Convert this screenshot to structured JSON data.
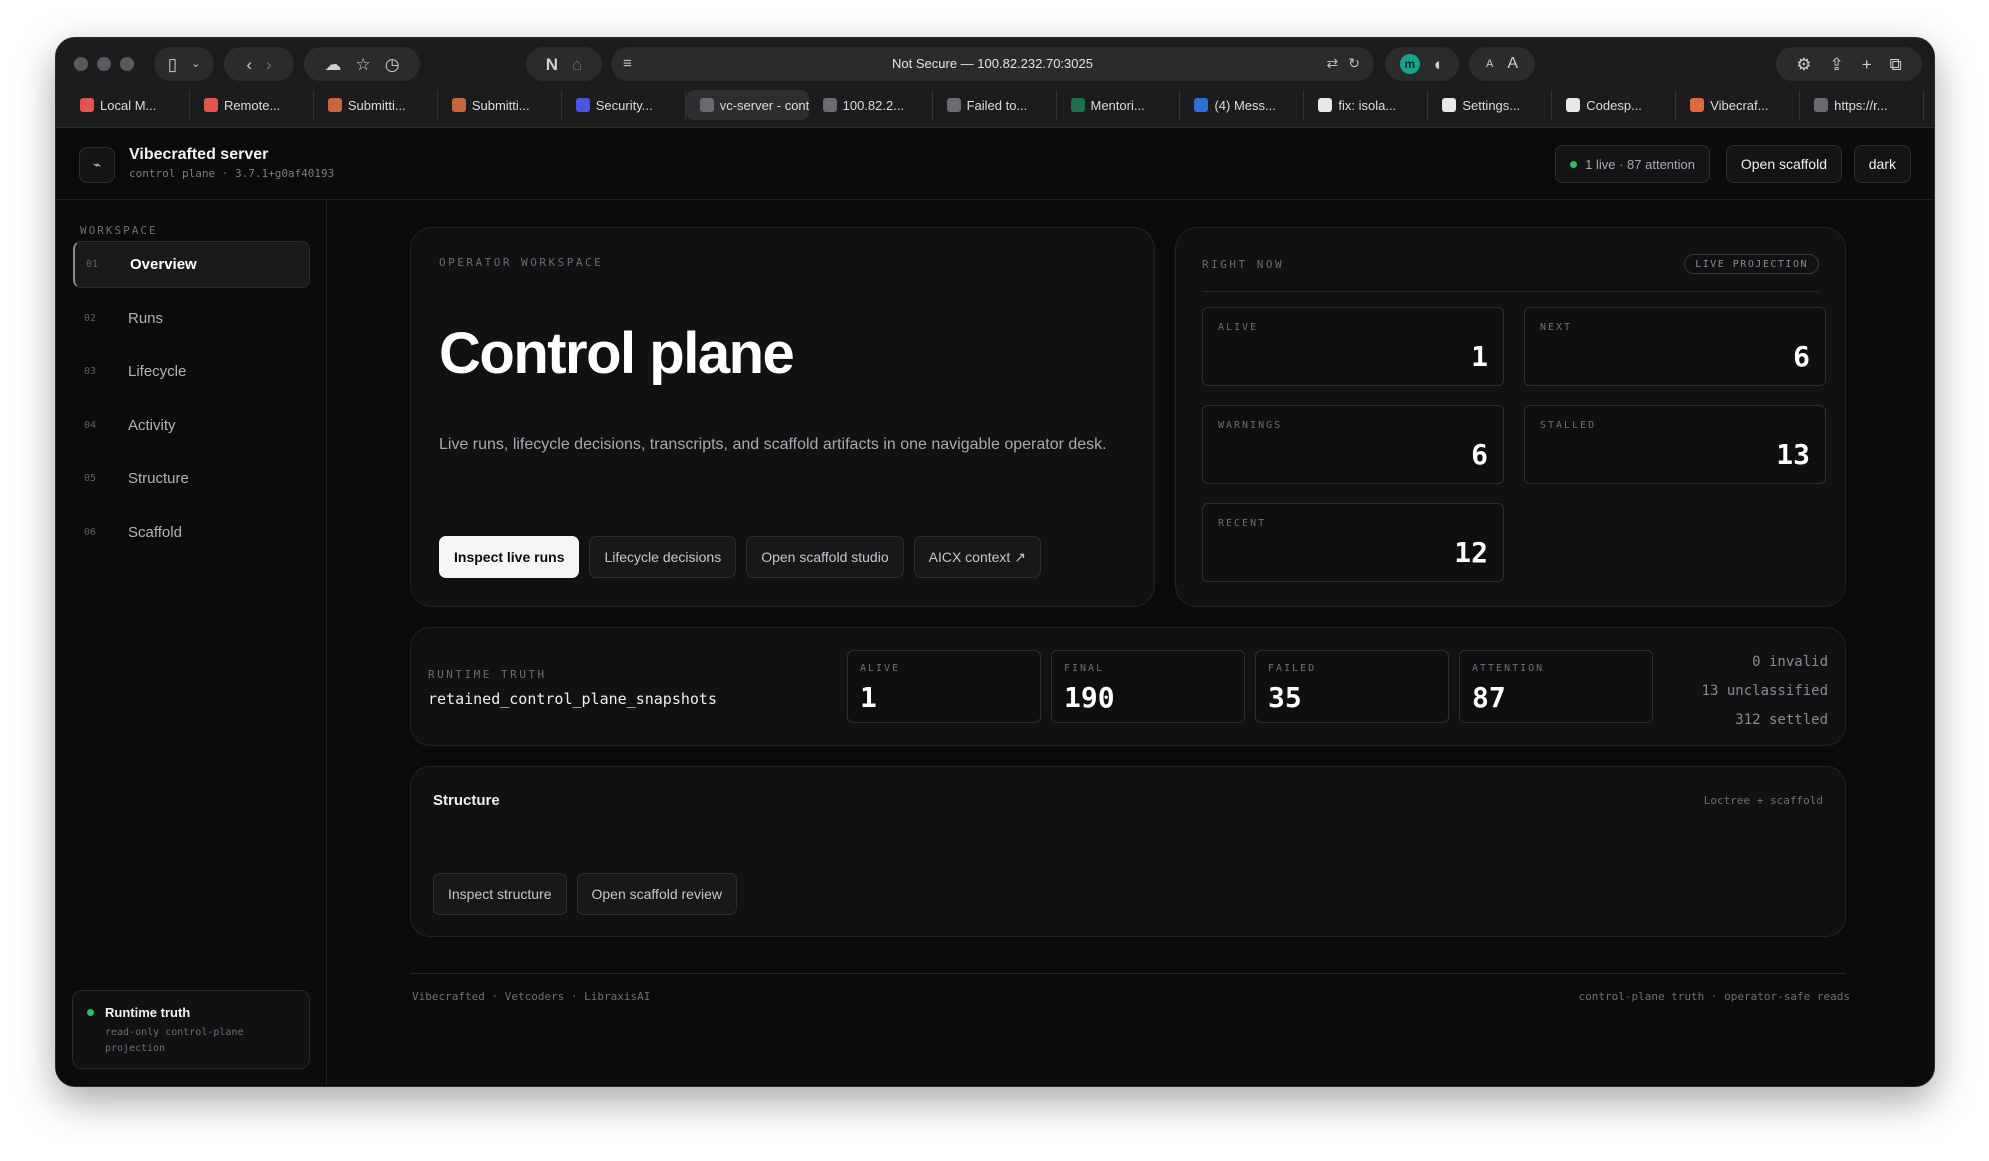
{
  "browser": {
    "url": "Not Secure — 100.82.232.70:3025",
    "ext_initial": "m",
    "text_size_small": "A",
    "text_size_large": "A",
    "tabs": [
      {
        "label": "Local M...",
        "color": "#e0564a"
      },
      {
        "label": "Remote...",
        "color": "#e0564a"
      },
      {
        "label": "Submitti...",
        "color": "#c9653b"
      },
      {
        "label": "Submitti...",
        "color": "#c9653b"
      },
      {
        "label": "Security...",
        "color": "#4a55e0"
      },
      {
        "label": "vc-server - control pl...",
        "color": "#6a6a70"
      },
      {
        "label": "100.82.2...",
        "color": "#6a6a70"
      },
      {
        "label": "Failed to...",
        "color": "#6a6a70"
      },
      {
        "label": "Mentori...",
        "color": "#1f6f4a"
      },
      {
        "label": "(4) Mess...",
        "color": "#2f6fd1"
      },
      {
        "label": "fix: isola...",
        "color": "#e8e8ea"
      },
      {
        "label": "Settings...",
        "color": "#e8e8ea"
      },
      {
        "label": "Codesp...",
        "color": "#e8e8ea"
      },
      {
        "label": "Vibecraf...",
        "color": "#e06a3a"
      },
      {
        "label": "https://r...",
        "color": "#6a6a70"
      }
    ],
    "active_tab_index": 5
  },
  "header": {
    "logo_glyph": "⌁",
    "title": "Vibecrafted server",
    "subtitle": "control plane · 3.7.1+g0af40193",
    "status": "1 live · 87 attention",
    "open_scaffold": "Open scaffold",
    "theme": "dark"
  },
  "sidebar": {
    "heading": "WORKSPACE",
    "items": [
      {
        "num": "01",
        "label": "Overview"
      },
      {
        "num": "02",
        "label": "Runs"
      },
      {
        "num": "03",
        "label": "Lifecycle"
      },
      {
        "num": "04",
        "label": "Activity"
      },
      {
        "num": "05",
        "label": "Structure"
      },
      {
        "num": "06",
        "label": "Scaffold"
      }
    ],
    "active_index": 0,
    "runtime_card": {
      "title": "Runtime truth",
      "subtitle": "read-only control-plane projection"
    }
  },
  "hero": {
    "eyebrow": "OPERATOR WORKSPACE",
    "title": "Control plane",
    "description": "Live runs, lifecycle decisions, transcripts, and scaffold artifacts in one navigable operator desk.",
    "buttons": {
      "inspect": "Inspect live runs",
      "lifecycle": "Lifecycle decisions",
      "studio": "Open scaffold studio",
      "aicx": "AICX context ↗"
    }
  },
  "right_now": {
    "eyebrow": "RIGHT NOW",
    "badge": "LIVE PROJECTION",
    "stats": [
      {
        "label": "ALIVE",
        "value": "1"
      },
      {
        "label": "NEXT",
        "value": "6"
      },
      {
        "label": "WARNINGS",
        "value": "6"
      },
      {
        "label": "STALLED",
        "value": "13"
      },
      {
        "label": "RECENT",
        "value": "12"
      }
    ]
  },
  "runtime_truth": {
    "eyebrow": "RUNTIME TRUTH",
    "source": "retained_control_plane_snapshots",
    "stats": [
      {
        "label": "ALIVE",
        "value": "1"
      },
      {
        "label": "FINAL",
        "value": "190"
      },
      {
        "label": "FAILED",
        "value": "35"
      },
      {
        "label": "ATTENTION",
        "value": "87"
      }
    ],
    "side": {
      "invalid": "0 invalid",
      "unclassified": "13 unclassified",
      "settled": "312 settled"
    }
  },
  "structure": {
    "title": "Structure",
    "meta": "Loctree + scaffold",
    "inspect": "Inspect structure",
    "review": "Open scaffold review"
  },
  "footer": {
    "left": "Vibecrafted · Vetcoders · LibraxisAI",
    "right": "control-plane truth · operator-safe reads"
  }
}
